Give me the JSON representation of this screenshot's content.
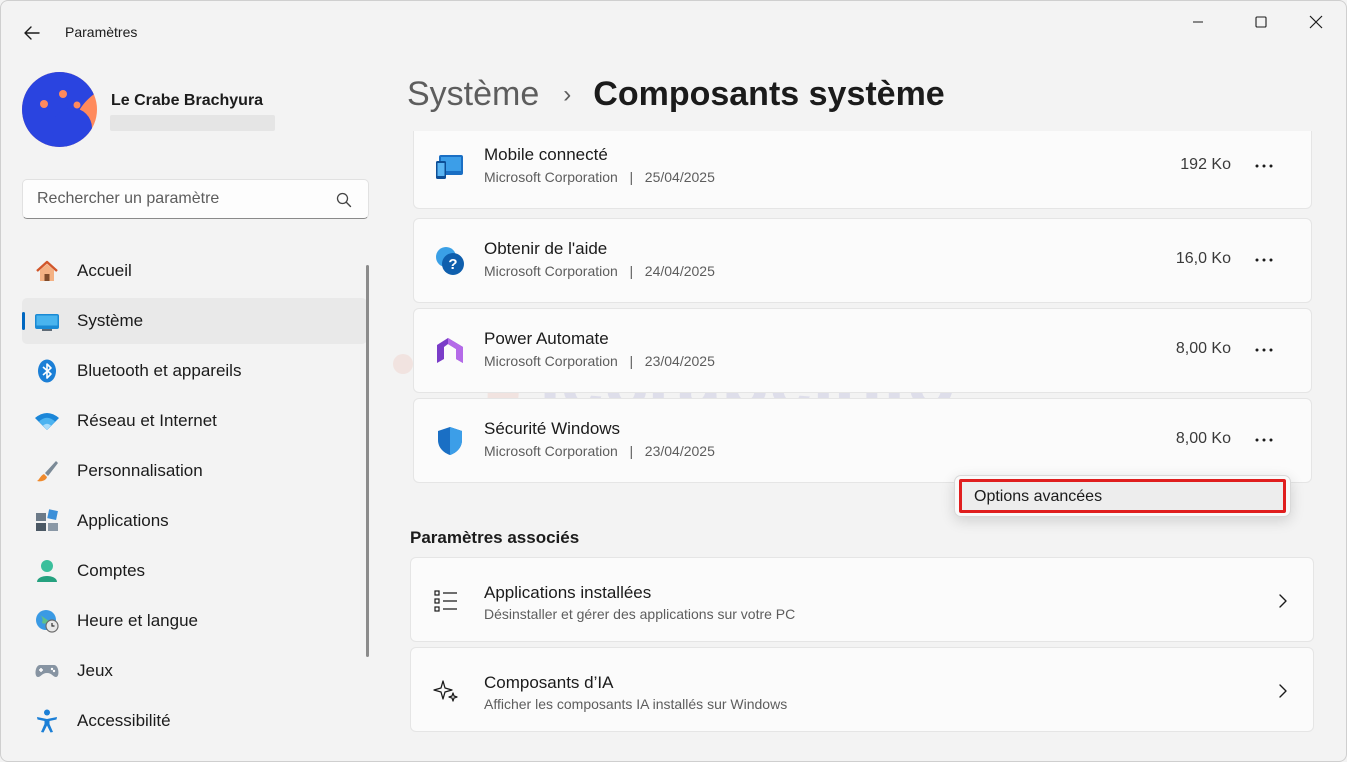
{
  "window": {
    "title": "Paramètres"
  },
  "profile": {
    "name": "Le Crabe Brachyura"
  },
  "search": {
    "placeholder": "Rechercher un paramètre"
  },
  "nav": {
    "items": [
      {
        "label": "Accueil",
        "icon": "home-icon"
      },
      {
        "label": "Système",
        "icon": "system-icon",
        "active": true
      },
      {
        "label": "Bluetooth et appareils",
        "icon": "bluetooth-icon"
      },
      {
        "label": "Réseau et Internet",
        "icon": "wifi-icon"
      },
      {
        "label": "Personnalisation",
        "icon": "brush-icon"
      },
      {
        "label": "Applications",
        "icon": "apps-icon"
      },
      {
        "label": "Comptes",
        "icon": "accounts-icon"
      },
      {
        "label": "Heure et langue",
        "icon": "time-language-icon"
      },
      {
        "label": "Jeux",
        "icon": "gamepad-icon"
      },
      {
        "label": "Accessibilité",
        "icon": "accessibility-icon"
      }
    ]
  },
  "breadcrumb": {
    "parent": "Système",
    "separator": "›",
    "current": "Composants système"
  },
  "components": [
    {
      "title": "Mobile connecté",
      "publisher": "Microsoft Corporation",
      "date": "25/04/2025",
      "sub": "Microsoft Corporation   |   25/04/2025",
      "size": "192 Ko",
      "icon": "phone-link-icon"
    },
    {
      "title": "Obtenir de l'aide",
      "publisher": "Microsoft Corporation",
      "date": "24/04/2025",
      "sub": "Microsoft Corporation   |   24/04/2025",
      "size": "16,0 Ko",
      "icon": "get-help-icon"
    },
    {
      "title": "Power Automate",
      "publisher": "Microsoft Corporation",
      "date": "23/04/2025",
      "sub": "Microsoft Corporation   |   23/04/2025",
      "size": "8,00 Ko",
      "icon": "power-automate-icon"
    },
    {
      "title": "Sécurité Windows",
      "publisher": "Microsoft Corporation",
      "date": "23/04/2025",
      "sub": "Microsoft Corporation   |   23/04/2025",
      "size": "8,00 Ko",
      "icon": "windows-security-icon"
    }
  ],
  "context_menu": {
    "items": [
      {
        "label": "Options avancées"
      }
    ]
  },
  "related": {
    "title": "Paramètres associés",
    "items": [
      {
        "title": "Applications installées",
        "sub": "Désinstaller et gérer des applications sur votre PC",
        "icon": "list-icon"
      },
      {
        "title": "Composants d’IA",
        "sub": "Afficher les composants IA installés sur Windows",
        "icon": "sparkle-icon"
      }
    ]
  },
  "watermark": {
    "text": "lecrabeinfo"
  },
  "colors": {
    "accent": "#0067c0",
    "highlight_border": "#e01e1e",
    "background": "#f3f3f3",
    "card": "#fbfbfb"
  }
}
